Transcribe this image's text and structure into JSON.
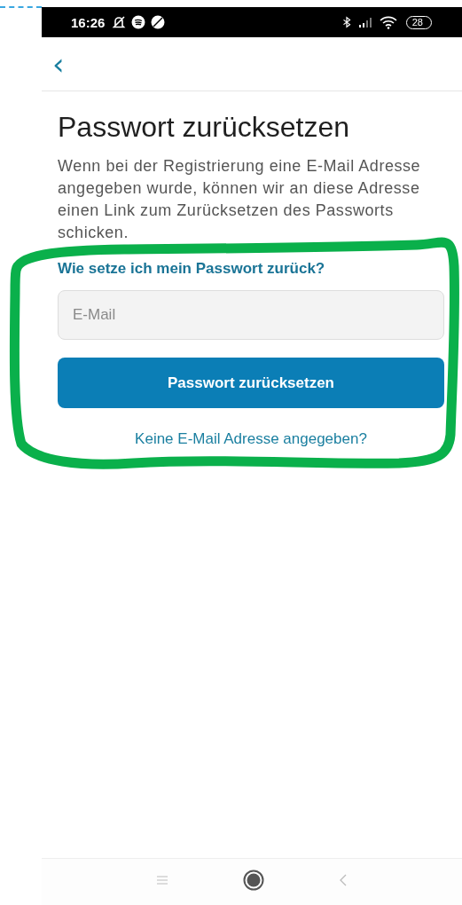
{
  "status_bar": {
    "time": "16:26",
    "battery": "28"
  },
  "header": {
    "back": "‹"
  },
  "title": "Passwort zurücksetzen",
  "description": "Wenn bei der Registrierung eine E-Mail Adresse angegeben wurde, können wir an diese Adresse einen Link zum Zurücksetzen des Passworts schicken.",
  "help_link": "Wie setze ich mein Passwort zurück?",
  "email_field": {
    "placeholder": "E-Mail"
  },
  "submit_button": "Passwort zurücksetzen",
  "no_email_link": "Keine E-Mail Adresse angegeben?",
  "overlays": {
    "dashed_edge": true,
    "loop": true
  }
}
